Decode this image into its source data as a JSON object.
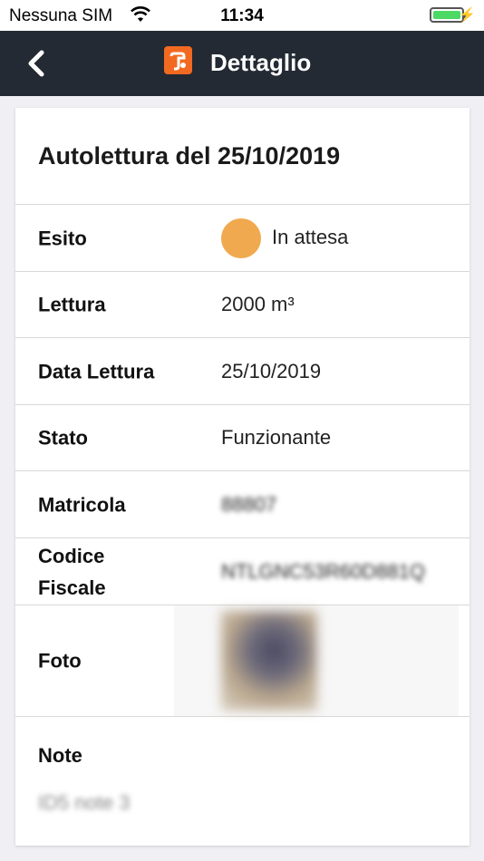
{
  "status_bar": {
    "carrier": "Nessuna SIM",
    "time": "11:34",
    "battery_color": "#4cd964",
    "wifi_icon": "wifi-icon",
    "charging_icon": "charging-bolt-icon"
  },
  "header": {
    "title": "Dettaglio",
    "back_icon": "chevron-left-icon",
    "logo_icon": "app-logo-icon",
    "logo_color": "#f26a21",
    "background": "#232a33"
  },
  "detail": {
    "title": "Autolettura del 25/10/2019",
    "esito": {
      "label": "Esito",
      "value": "In attesa",
      "status_color": "#f0a94e"
    },
    "lettura": {
      "label": "Lettura",
      "value": "2000 m³"
    },
    "data_lettura": {
      "label": "Data Lettura",
      "value": "25/10/2019"
    },
    "stato": {
      "label": "Stato",
      "value": "Funzionante"
    },
    "matricola": {
      "label": "Matricola",
      "value": "88807"
    },
    "codice_fiscale": {
      "label_line1": "Codice",
      "label_line2": "Fiscale",
      "value": "NTLGNC53R60D881Q"
    },
    "foto": {
      "label": "Foto"
    },
    "note": {
      "label": "Note",
      "value": "ID5 note 3"
    }
  }
}
